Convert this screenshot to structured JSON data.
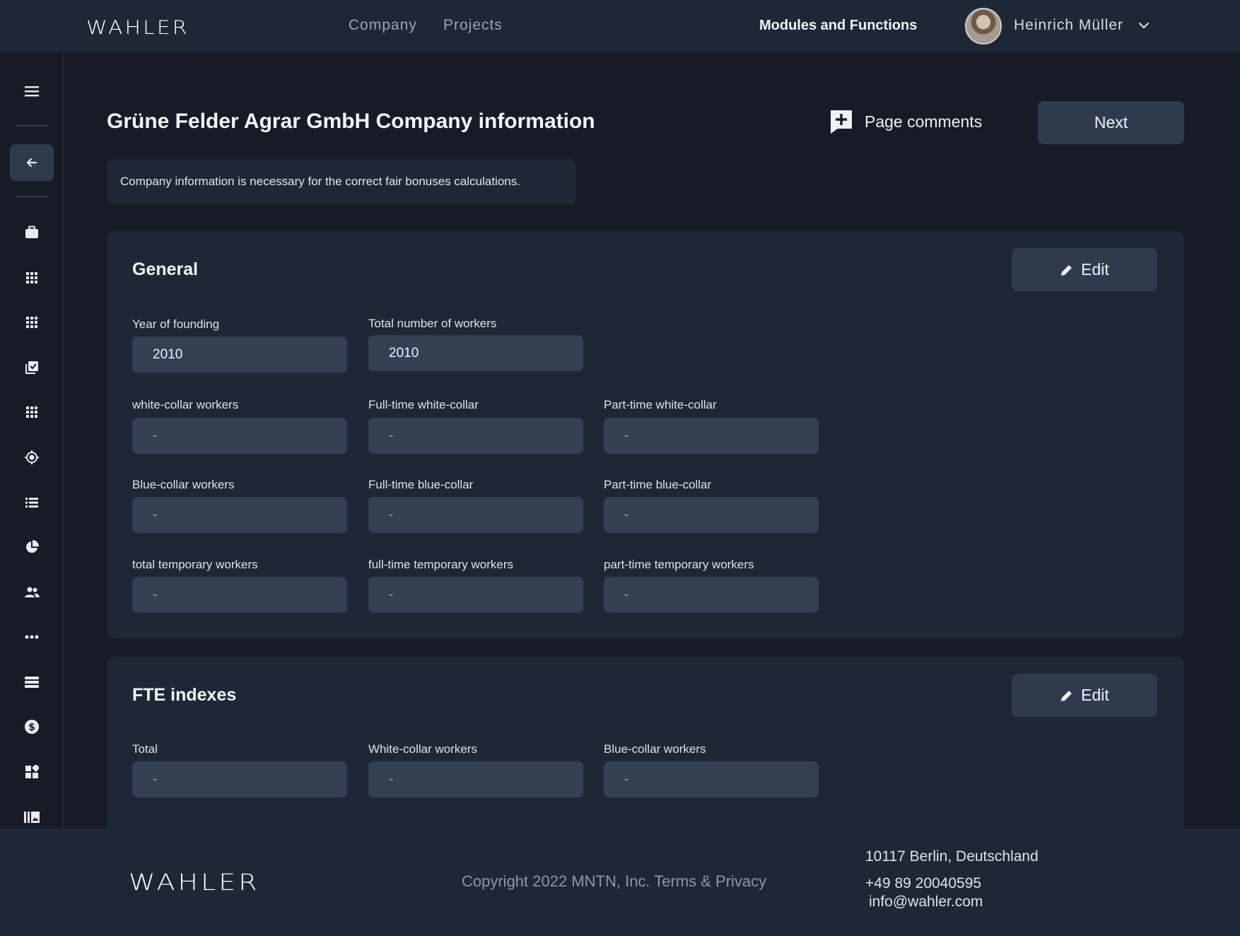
{
  "header": {
    "logo": "WAHLER",
    "nav": [
      "Company",
      "Projects"
    ],
    "modules_label": "Modules and Functions",
    "user_name": "Heinrich Müller"
  },
  "sidebar": {
    "icons": [
      "menu-icon",
      "arrow-left-icon",
      "briefcase-icon",
      "grid-icon",
      "grid-plus-icon",
      "checklist-icon",
      "grid-plus-icon-2",
      "target-icon",
      "list-icon",
      "pie-chart-icon",
      "users-icon",
      "dots-icon",
      "stacked-list-icon",
      "dollar-icon",
      "dashboard-icon",
      "library-icon"
    ]
  },
  "main": {
    "title": "Grüne Felder Agrar GmbH Company information",
    "page_comments_label": "Page comments",
    "next_label": "Next",
    "info_note": "Company information is necessary for the correct fair bonuses calculations."
  },
  "general": {
    "title": "General",
    "edit_label": "Edit",
    "fields": [
      {
        "label": "Year of founding",
        "value": "2010"
      },
      {
        "label": "Total number of workers",
        "value": "2010"
      },
      {
        "label": "white-collar workers",
        "value": "-"
      },
      {
        "label": "Full-time white-collar",
        "value": "-"
      },
      {
        "label": "Part-time white-collar",
        "value": "-"
      },
      {
        "label": "Blue-collar workers",
        "value": "-"
      },
      {
        "label": "Full-time  blue-collar",
        "value": "-"
      },
      {
        "label": "Part-time blue-collar",
        "value": "-"
      },
      {
        "label": "total temporary workers",
        "value": "-"
      },
      {
        "label": "full-time temporary workers",
        "value": "-"
      },
      {
        "label": "part-time temporary workers",
        "value": "-"
      }
    ]
  },
  "fte": {
    "title": "FTE indexes",
    "edit_label": "Edit",
    "fields": [
      {
        "label": "Total",
        "value": "-"
      },
      {
        "label": "White-collar workers",
        "value": "-"
      },
      {
        "label": "Blue-collar workers",
        "value": "-"
      }
    ]
  },
  "footer": {
    "logo": "WAHLER",
    "copyright": "Copyright 2022 MNTN, Inc. Terms & Privacy",
    "address": "10117 Berlin, Deutschland",
    "phone": "+49 89 20040595",
    "email": "info@wahler.com"
  },
  "colors": {
    "background": "#161b25",
    "surface": "#1e2735",
    "button": "#2e3b4f",
    "field": "#333f52"
  }
}
